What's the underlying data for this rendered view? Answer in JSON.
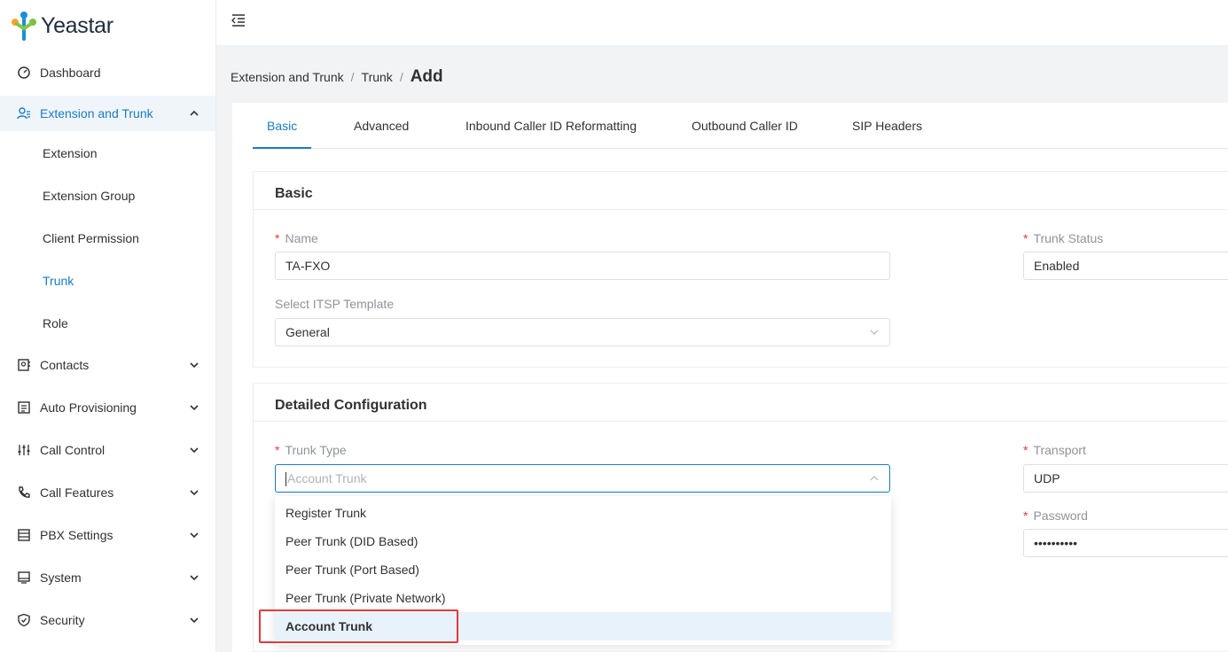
{
  "brand": {
    "name": "Yeastar"
  },
  "sidebar": {
    "items": [
      {
        "label": "Dashboard",
        "icon": "dashboard-icon"
      },
      {
        "label": "Extension and Trunk",
        "icon": "users-icon",
        "expanded": true
      },
      {
        "label": "Contacts",
        "icon": "contacts-icon"
      },
      {
        "label": "Auto Provisioning",
        "icon": "provisioning-icon"
      },
      {
        "label": "Call Control",
        "icon": "sliders-icon"
      },
      {
        "label": "Call Features",
        "icon": "phone-icon"
      },
      {
        "label": "PBX Settings",
        "icon": "settings-list-icon"
      },
      {
        "label": "System",
        "icon": "monitor-icon"
      },
      {
        "label": "Security",
        "icon": "shield-icon"
      }
    ],
    "subitems": [
      "Extension",
      "Extension Group",
      "Client Permission",
      "Trunk",
      "Role"
    ],
    "active_subitem": "Trunk"
  },
  "breadcrumb": {
    "level1": "Extension and Trunk",
    "level2": "Trunk",
    "current": "Add",
    "separator": "/"
  },
  "tabs": [
    "Basic",
    "Advanced",
    "Inbound Caller ID Reformatting",
    "Outbound Caller ID",
    "SIP Headers"
  ],
  "active_tab": "Basic",
  "basic": {
    "title": "Basic",
    "name_label": "Name",
    "name_value": "TA-FXO",
    "trunk_status_label": "Trunk Status",
    "trunk_status_value": "Enabled",
    "itsp_label": "Select ITSP Template",
    "itsp_value": "General"
  },
  "detailed": {
    "title": "Detailed Configuration",
    "trunk_type_label": "Trunk Type",
    "trunk_type_placeholder": "Account Trunk",
    "transport_label": "Transport",
    "transport_value": "UDP",
    "password_label": "Password",
    "password_value": "••••••••••"
  },
  "dropdown": {
    "options": [
      "Register Trunk",
      "Peer Trunk (DID Based)",
      "Peer Trunk (Port Based)",
      "Peer Trunk (Private Network)",
      "Account Trunk"
    ],
    "selected": "Account Trunk"
  },
  "colors": {
    "accent": "#1a7bc4",
    "required": "#e4393c",
    "highlight": "#e4393c"
  }
}
